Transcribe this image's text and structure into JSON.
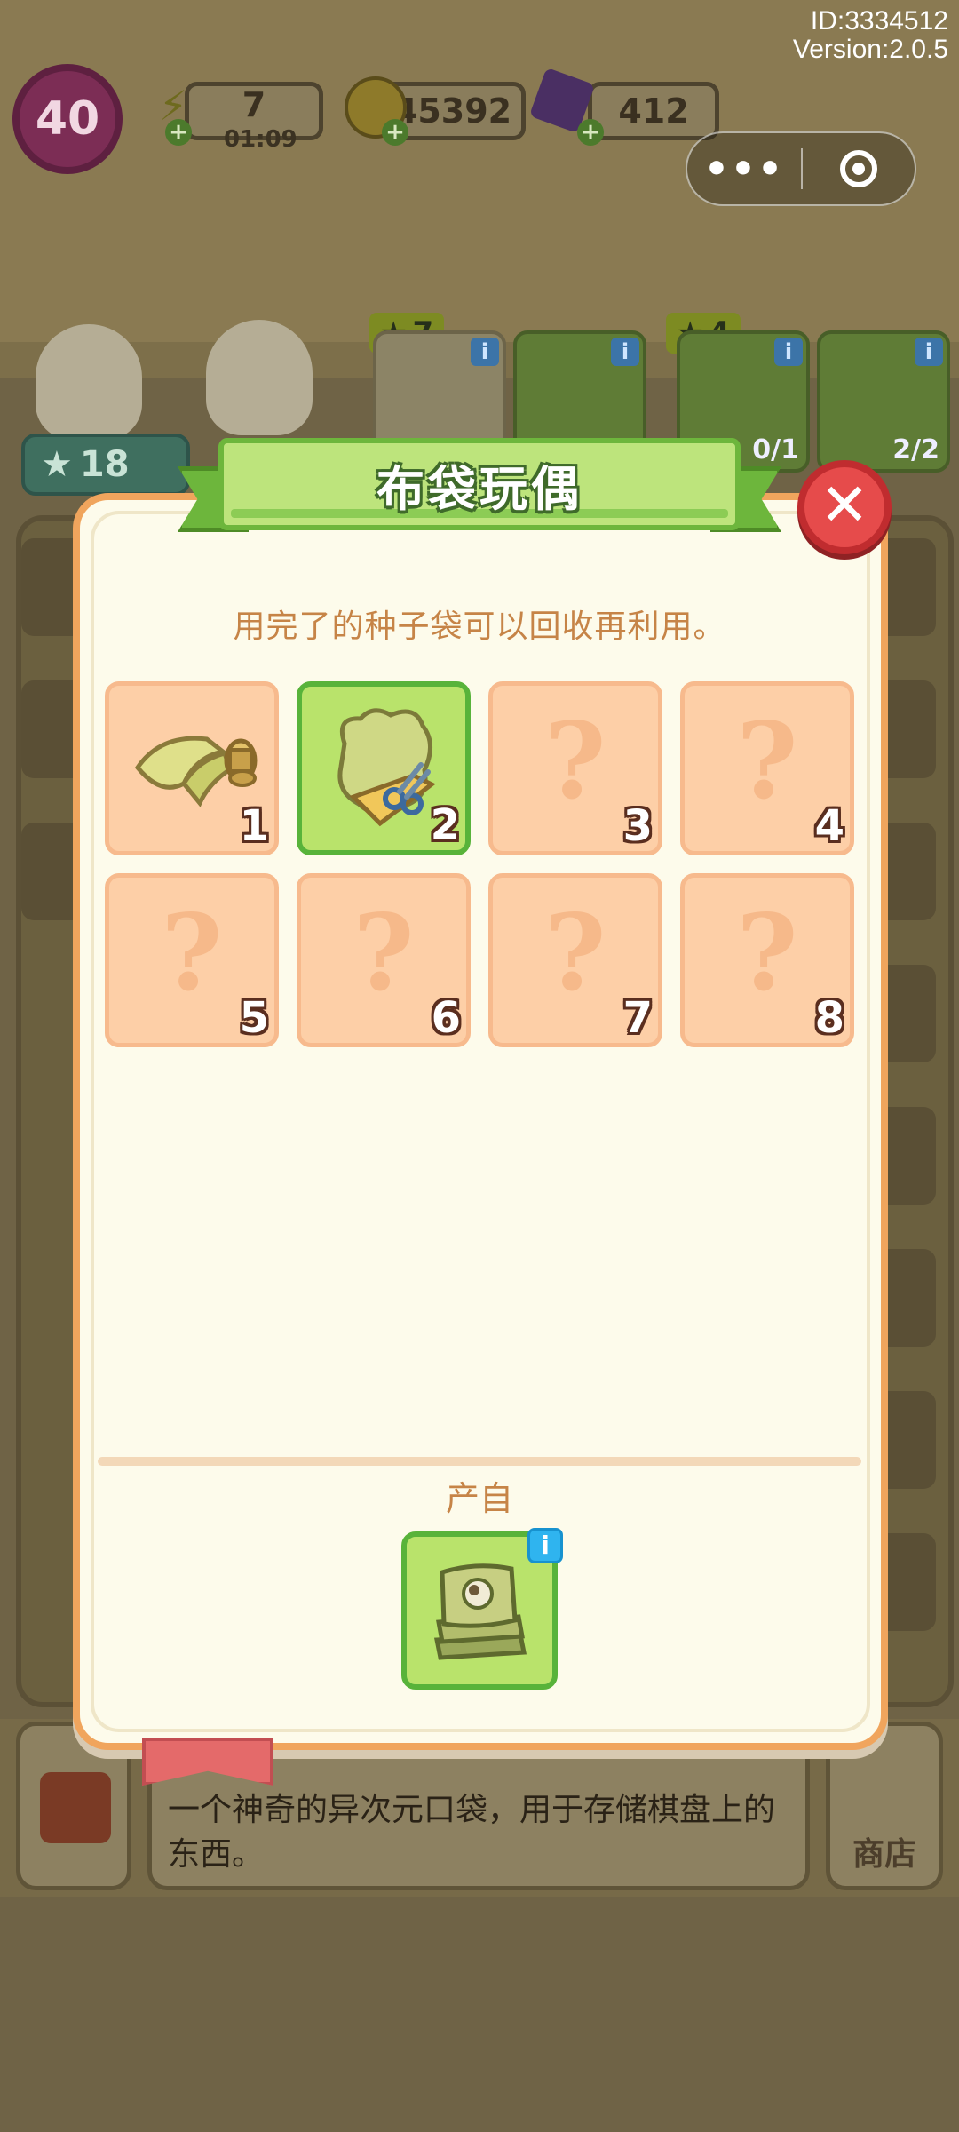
{
  "build": {
    "id": "ID:3334512",
    "version": "Version:2.0.5"
  },
  "hud": {
    "level": "40",
    "energy": "7",
    "energy_timer": "01:09",
    "coins": "45392",
    "gems": "412"
  },
  "capsule": {
    "more": "•••"
  },
  "background": {
    "player_stars": "18",
    "orders": [
      {
        "stars": "7",
        "progress": ""
      },
      {
        "stars": "4",
        "progress": "0/1"
      },
      {
        "progress": "2/2"
      }
    ],
    "description": "一个神奇的异次元口袋，用于存储棋盘上的东西。",
    "shop_label": "商店"
  },
  "modal": {
    "title": "布袋玩偶",
    "hint": "用完了的种子袋可以回收再利用。",
    "slots": [
      {
        "num": "1",
        "state": "unlocked",
        "item": "cloth-roll-with-thread"
      },
      {
        "num": "2",
        "state": "current",
        "item": "fabric-with-scissors"
      },
      {
        "num": "3",
        "state": "locked",
        "q": "?"
      },
      {
        "num": "4",
        "state": "locked",
        "q": "?"
      },
      {
        "num": "5",
        "state": "locked",
        "q": "?"
      },
      {
        "num": "6",
        "state": "locked",
        "q": "?"
      },
      {
        "num": "7",
        "state": "locked",
        "q": "?"
      },
      {
        "num": "8",
        "state": "locked",
        "q": "?"
      }
    ],
    "source_label": "产自",
    "source_item": "seed-bag-stack",
    "info": "i",
    "close": "✕"
  }
}
